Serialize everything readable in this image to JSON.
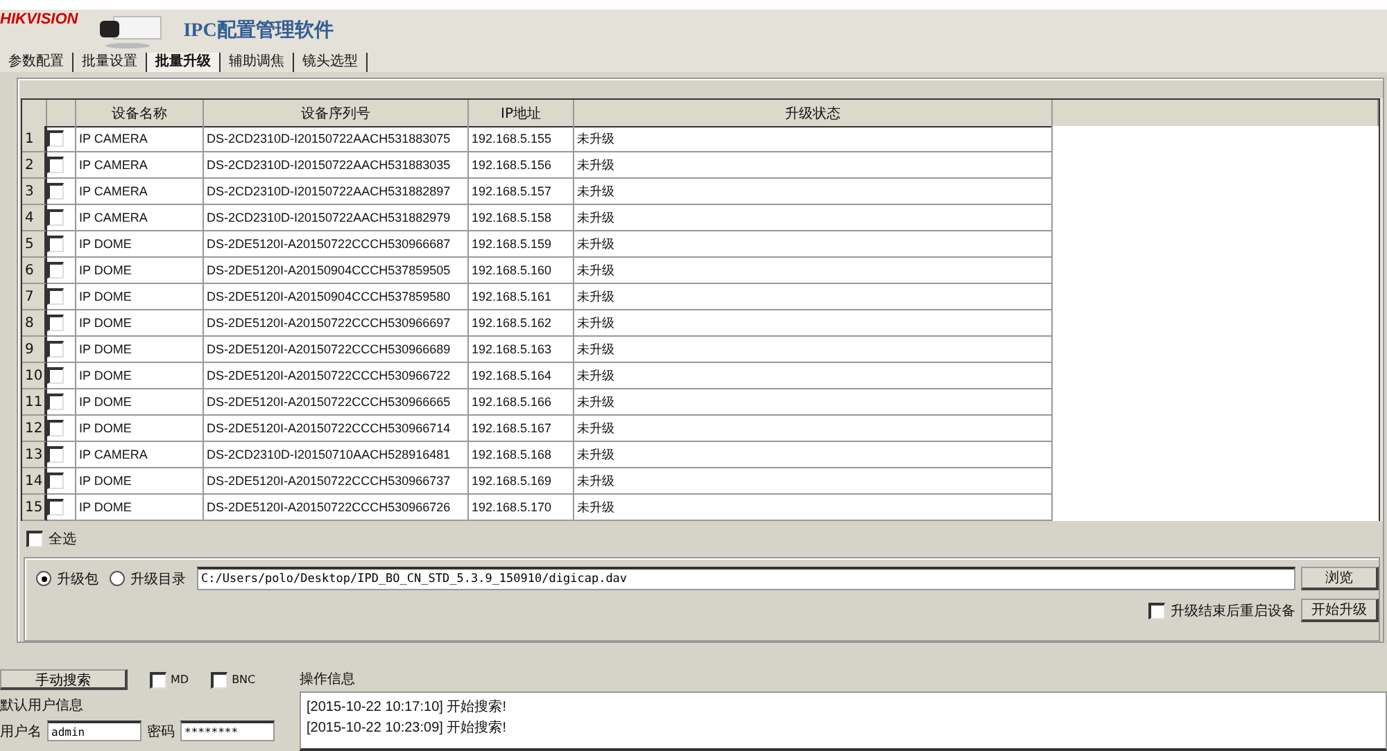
{
  "header": {
    "logo": "HIKVISION",
    "title": "IPC配置管理软件"
  },
  "tabs": [
    {
      "label": "参数配置",
      "selected": false
    },
    {
      "label": "批量设置",
      "selected": false
    },
    {
      "label": "批量升级",
      "selected": true
    },
    {
      "label": "辅助调焦",
      "selected": false
    },
    {
      "label": "镜头选型",
      "selected": false
    }
  ],
  "table": {
    "columns": [
      "设备名称",
      "设备序列号",
      "IP地址",
      "升级状态"
    ],
    "rows": [
      {
        "index": "1",
        "checked": false,
        "name": "IP CAMERA",
        "serial": "DS-2CD2310D-I20150722AACH531883075",
        "ip": "192.168.5.155",
        "status": "未升级"
      },
      {
        "index": "2",
        "checked": false,
        "name": "IP CAMERA",
        "serial": "DS-2CD2310D-I20150722AACH531883035",
        "ip": "192.168.5.156",
        "status": "未升级"
      },
      {
        "index": "3",
        "checked": false,
        "name": "IP CAMERA",
        "serial": "DS-2CD2310D-I20150722AACH531882897",
        "ip": "192.168.5.157",
        "status": "未升级"
      },
      {
        "index": "4",
        "checked": false,
        "name": "IP CAMERA",
        "serial": "DS-2CD2310D-I20150722AACH531882979",
        "ip": "192.168.5.158",
        "status": "未升级"
      },
      {
        "index": "5",
        "checked": false,
        "name": "IP DOME",
        "serial": "DS-2DE5120I-A20150722CCCH530966687",
        "ip": "192.168.5.159",
        "status": "未升级"
      },
      {
        "index": "6",
        "checked": false,
        "name": "IP DOME",
        "serial": "DS-2DE5120I-A20150904CCCH537859505",
        "ip": "192.168.5.160",
        "status": "未升级"
      },
      {
        "index": "7",
        "checked": false,
        "name": "IP DOME",
        "serial": "DS-2DE5120I-A20150904CCCH537859580",
        "ip": "192.168.5.161",
        "status": "未升级"
      },
      {
        "index": "8",
        "checked": false,
        "name": "IP DOME",
        "serial": "DS-2DE5120I-A20150722CCCH530966697",
        "ip": "192.168.5.162",
        "status": "未升级"
      },
      {
        "index": "9",
        "checked": false,
        "name": "IP DOME",
        "serial": "DS-2DE5120I-A20150722CCCH530966689",
        "ip": "192.168.5.163",
        "status": "未升级"
      },
      {
        "index": "10",
        "checked": false,
        "name": "IP DOME",
        "serial": "DS-2DE5120I-A20150722CCCH530966722",
        "ip": "192.168.5.164",
        "status": "未升级"
      },
      {
        "index": "11",
        "checked": false,
        "name": "IP DOME",
        "serial": "DS-2DE5120I-A20150722CCCH530966665",
        "ip": "192.168.5.166",
        "status": "未升级"
      },
      {
        "index": "12",
        "checked": false,
        "name": "IP DOME",
        "serial": "DS-2DE5120I-A20150722CCCH530966714",
        "ip": "192.168.5.167",
        "status": "未升级"
      },
      {
        "index": "13",
        "checked": false,
        "name": "IP CAMERA",
        "serial": "DS-2CD2310D-I20150710AACH528916481",
        "ip": "192.168.5.168",
        "status": "未升级"
      },
      {
        "index": "14",
        "checked": false,
        "name": "IP DOME",
        "serial": "DS-2DE5120I-A20150722CCCH530966737",
        "ip": "192.168.5.169",
        "status": "未升级"
      },
      {
        "index": "15",
        "checked": false,
        "name": "IP DOME",
        "serial": "DS-2DE5120I-A20150722CCCH530966726",
        "ip": "192.168.5.170",
        "status": "未升级"
      }
    ]
  },
  "select_all": {
    "label": "全选",
    "checked": false
  },
  "upgrade": {
    "options": [
      {
        "label": "升级包",
        "selected": true
      },
      {
        "label": "升级目录",
        "selected": false
      }
    ],
    "path": "C:/Users/polo/Desktop/IPD_BO_CN_STD_5.3.9_150910/digicap.dav",
    "browse_button": "浏览",
    "reboot": {
      "label": "升级结束后重启设备",
      "checked": false
    },
    "start_button": "开始升级"
  },
  "search_button": "手动搜索",
  "filters": [
    {
      "label": "MD",
      "checked": false
    },
    {
      "label": "BNC",
      "checked": false
    }
  ],
  "user_info": {
    "title": "默认用户信息",
    "username_label": "用户名",
    "username": "admin",
    "password_label": "密码",
    "password": "********"
  },
  "log": {
    "title": "操作信息",
    "lines": [
      "[2015-10-22 10:17:10] 开始搜索!",
      "[2015-10-22 10:23:09] 开始搜索!"
    ]
  }
}
